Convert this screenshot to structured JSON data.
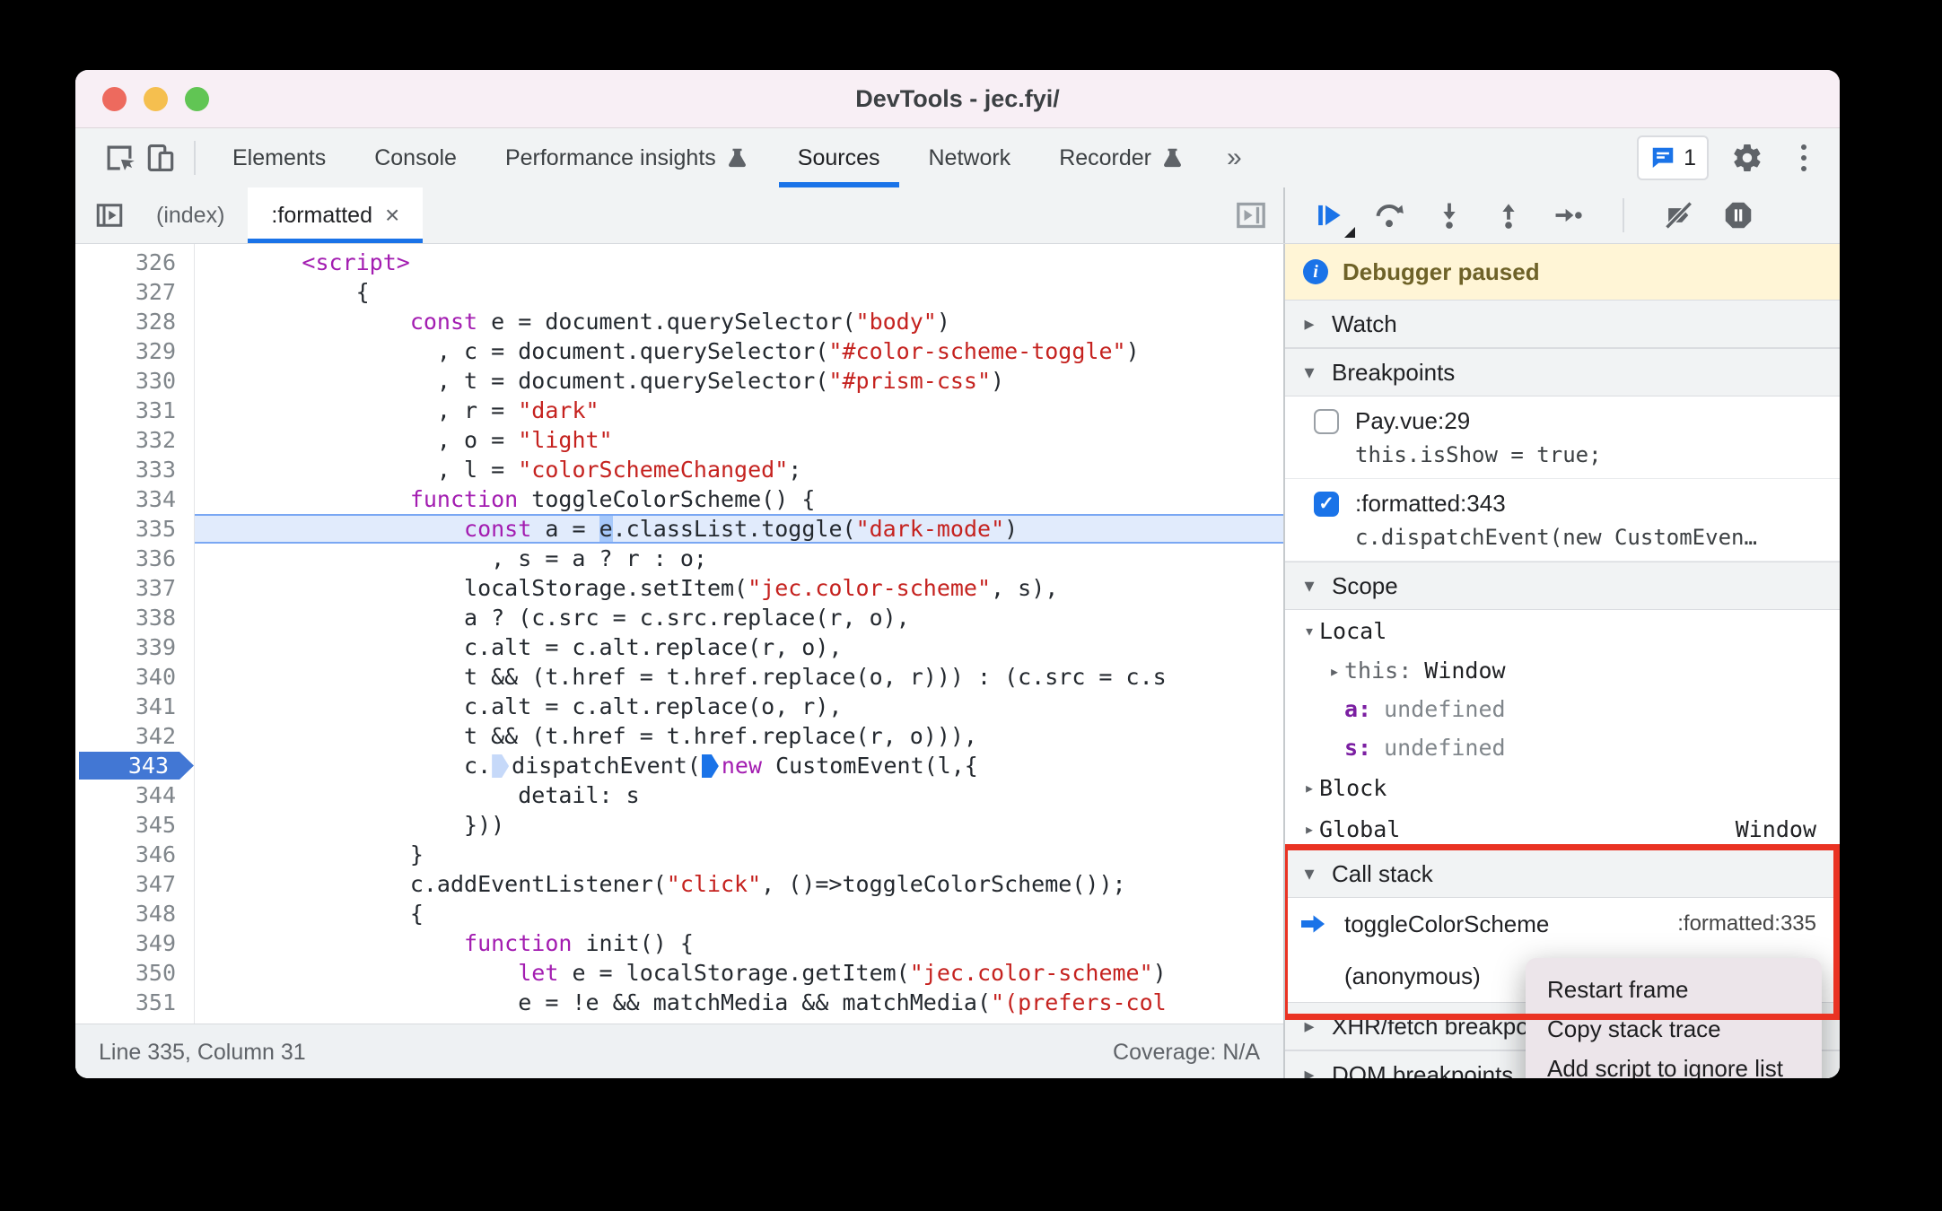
{
  "window": {
    "title": "DevTools - jec.fyi/"
  },
  "glyphs": {
    "tri_down": "▾",
    "tri_right": "▸",
    "close": "×",
    "more": "»",
    "check": "✓"
  },
  "colors": {
    "accent": "#1a73e8",
    "annotation_red": "#ea3323",
    "paused_banner_bg": "#fff5d6",
    "keyword": "#a31db1",
    "string": "#c5221f",
    "exec_line_bg": "#e1ebfc",
    "traffic_lights": [
      "#ed6a5e",
      "#f5bf4f",
      "#61c554"
    ]
  },
  "toolbar": {
    "badge_count": "1",
    "tabs": [
      {
        "label": "Elements",
        "flask": false,
        "active": false
      },
      {
        "label": "Console",
        "flask": false,
        "active": false
      },
      {
        "label": "Performance insights",
        "flask": true,
        "active": false
      },
      {
        "label": "Sources",
        "flask": false,
        "active": true
      },
      {
        "label": "Network",
        "flask": false,
        "active": false
      },
      {
        "label": "Recorder",
        "flask": true,
        "active": false
      }
    ],
    "icons": [
      "inspect-icon",
      "device-toolbar-icon",
      "more-tabs-chevron",
      "console-messages-badge",
      "settings-gear-icon",
      "customize-menu-icon"
    ]
  },
  "file_tabs": {
    "items": [
      {
        "label": "(index)",
        "active": false
      },
      {
        "label": ":formatted",
        "active": true,
        "closable": true
      }
    ]
  },
  "debugger_controls": [
    "resume",
    "step-over",
    "step-into",
    "step-out",
    "step",
    "deactivate-breakpoints",
    "pause-on-exceptions"
  ],
  "editor": {
    "lines": [
      {
        "n": 326,
        "t": [
          [
            "p",
            "        "
          ],
          [
            "k",
            "<script>"
          ]
        ]
      },
      {
        "n": 327,
        "t": [
          [
            "p",
            "            {"
          ]
        ]
      },
      {
        "n": 328,
        "t": [
          [
            "p",
            "                "
          ],
          [
            "k",
            "const"
          ],
          [
            "p",
            " e = document.querySelector("
          ],
          [
            "s",
            "\"body\""
          ],
          [
            "p",
            ")"
          ]
        ]
      },
      {
        "n": 329,
        "t": [
          [
            "p",
            "                  , c = document.querySelector("
          ],
          [
            "s",
            "\"#color-scheme-toggle\""
          ],
          [
            "p",
            ")"
          ]
        ]
      },
      {
        "n": 330,
        "t": [
          [
            "p",
            "                  , t = document.querySelector("
          ],
          [
            "s",
            "\"#prism-css\""
          ],
          [
            "p",
            ")"
          ]
        ]
      },
      {
        "n": 331,
        "t": [
          [
            "p",
            "                  , r = "
          ],
          [
            "s",
            "\"dark\""
          ]
        ]
      },
      {
        "n": 332,
        "t": [
          [
            "p",
            "                  , o = "
          ],
          [
            "s",
            "\"light\""
          ]
        ]
      },
      {
        "n": 333,
        "t": [
          [
            "p",
            "                  , l = "
          ],
          [
            "s",
            "\"colorSchemeChanged\""
          ],
          [
            "p",
            ";"
          ]
        ]
      },
      {
        "n": 334,
        "t": [
          [
            "p",
            "                "
          ],
          [
            "k",
            "function"
          ],
          [
            "p",
            " toggleColorScheme() {"
          ]
        ]
      },
      {
        "n": 335,
        "exec": true,
        "t": [
          [
            "p",
            "                    "
          ],
          [
            "k",
            "const"
          ],
          [
            "p",
            " a = "
          ],
          [
            "sel",
            "e"
          ],
          [
            "p",
            ".classList.toggle("
          ],
          [
            "s",
            "\"dark-mode\""
          ],
          [
            "p",
            ")"
          ]
        ]
      },
      {
        "n": 336,
        "t": [
          [
            "p",
            "                      , s = a ? r : o;"
          ]
        ]
      },
      {
        "n": 337,
        "t": [
          [
            "p",
            "                    localStorage.setItem("
          ],
          [
            "s",
            "\"jec.color-scheme\""
          ],
          [
            "p",
            ", s),"
          ]
        ]
      },
      {
        "n": 338,
        "t": [
          [
            "p",
            "                    a ? (c.src = c.src.replace(r, o),"
          ]
        ]
      },
      {
        "n": 339,
        "t": [
          [
            "p",
            "                    c.alt = c.alt.replace(r, o),"
          ]
        ]
      },
      {
        "n": 340,
        "t": [
          [
            "p",
            "                    t && (t.href = t.href.replace(o, r))) : (c.src = c.s"
          ]
        ]
      },
      {
        "n": 341,
        "t": [
          [
            "p",
            "                    c.alt = c.alt.replace(o, r),"
          ]
        ]
      },
      {
        "n": 342,
        "t": [
          [
            "p",
            "                    t && (t.href = t.href.replace(r, o))),"
          ]
        ]
      },
      {
        "n": 343,
        "bp": true,
        "t": [
          [
            "p",
            "                    c."
          ],
          [
            "m1",
            ""
          ],
          [
            "p",
            "dispatchEvent("
          ],
          [
            "m2",
            ""
          ],
          [
            "k",
            "new"
          ],
          [
            "p",
            " CustomEvent(l,{"
          ]
        ]
      },
      {
        "n": 344,
        "t": [
          [
            "p",
            "                        detail: s"
          ]
        ]
      },
      {
        "n": 345,
        "t": [
          [
            "p",
            "                    }))"
          ]
        ]
      },
      {
        "n": 346,
        "t": [
          [
            "p",
            "                }"
          ]
        ]
      },
      {
        "n": 347,
        "t": [
          [
            "p",
            "                c.addEventListener("
          ],
          [
            "s",
            "\"click\""
          ],
          [
            "p",
            ", ()=>toggleColorScheme());"
          ]
        ]
      },
      {
        "n": 348,
        "t": [
          [
            "p",
            "                {"
          ]
        ]
      },
      {
        "n": 349,
        "t": [
          [
            "p",
            "                    "
          ],
          [
            "k",
            "function"
          ],
          [
            "p",
            " init() {"
          ]
        ]
      },
      {
        "n": 350,
        "t": [
          [
            "p",
            "                        "
          ],
          [
            "k",
            "let"
          ],
          [
            "p",
            " e = localStorage.getItem("
          ],
          [
            "s",
            "\"jec.color-scheme\""
          ],
          [
            "p",
            ")"
          ]
        ]
      },
      {
        "n": 351,
        "t": [
          [
            "p",
            "                        e = !e && matchMedia && matchMedia("
          ],
          [
            "s",
            "\"(prefers-col"
          ]
        ]
      }
    ]
  },
  "status_bar": {
    "left": "Line 335, Column 31",
    "right": "Coverage: N/A"
  },
  "sidebar": {
    "paused_banner": "Debugger paused",
    "watch_title": "Watch",
    "breakpoints_title": "Breakpoints",
    "breakpoints": {
      "items": [
        {
          "checked": false,
          "location": "Pay.vue:29",
          "code": "this.isShow = true;"
        },
        {
          "checked": true,
          "location": ":formatted:343",
          "code": "c.dispatchEvent(new CustomEven…"
        }
      ]
    },
    "scope_title": "Scope",
    "scope": {
      "groups": [
        {
          "name": "Local",
          "expanded": true,
          "items": [
            {
              "key": "this:",
              "value": "Window",
              "expandable": true,
              "style": "this"
            },
            {
              "key": "a:",
              "value": "undefined",
              "style": "var"
            },
            {
              "key": "s:",
              "value": "undefined",
              "style": "var"
            }
          ]
        },
        {
          "name": "Block",
          "expanded": false,
          "items": []
        },
        {
          "name": "Global",
          "expanded": false,
          "value": "Window",
          "items": []
        }
      ]
    },
    "call_stack_title": "Call stack",
    "call_stack": {
      "frames": [
        {
          "name": "toggleColorScheme",
          "location": ":formatted:335",
          "current": true
        },
        {
          "name": "(anonymous)",
          "location": "",
          "current": false
        }
      ]
    },
    "xhr_title": "XHR/fetch breakpoints",
    "dom_title": "DOM breakpoints"
  },
  "context_menu": {
    "items": [
      "Restart frame",
      "Copy stack trace",
      "Add script to ignore list"
    ]
  }
}
